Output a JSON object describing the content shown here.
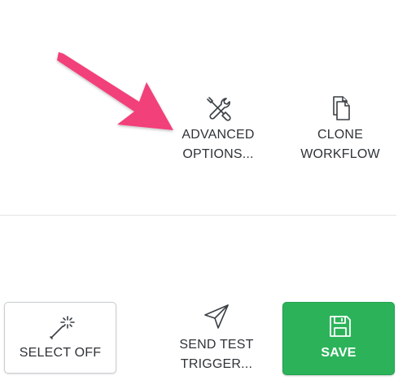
{
  "top_actions": {
    "advanced_options": {
      "label": "ADVANCED\nOPTIONS...",
      "icon": "tools-icon"
    },
    "clone_workflow": {
      "label": "CLONE\nWORKFLOW",
      "icon": "copy-documents-icon"
    }
  },
  "bottom_actions": {
    "select_off": {
      "label": "SELECT OFF",
      "icon": "magic-wand-icon"
    },
    "send_test_trigger": {
      "label": "SEND TEST\nTRIGGER...",
      "icon": "paper-plane-icon"
    },
    "save": {
      "label": "SAVE",
      "icon": "floppy-disk-icon"
    }
  },
  "annotation": {
    "icon": "pink-arrow-pointer",
    "color": "#f23f7a"
  },
  "colors": {
    "save_button": "#2cb35a",
    "text": "#2f3337",
    "divider": "#e4e6e8"
  }
}
